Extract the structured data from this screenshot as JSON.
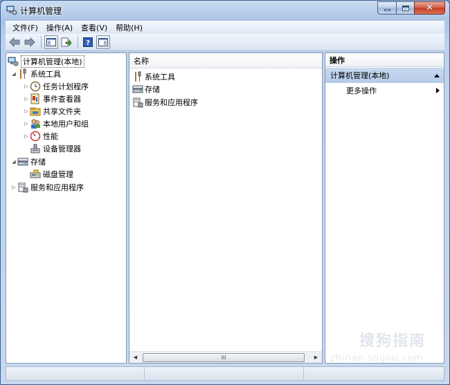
{
  "window": {
    "title": "计算机管理",
    "close_glyph": "✕"
  },
  "menu": {
    "items": [
      "文件(F)",
      "操作(A)",
      "查看(V)",
      "帮助(H)"
    ]
  },
  "tree": {
    "root": "计算机管理(本地)",
    "system_tools": "系统工具",
    "task_scheduler": "任务计划程序",
    "event_viewer": "事件查看器",
    "shared_folders": "共享文件夹",
    "local_users": "本地用户和组",
    "performance": "性能",
    "device_manager": "设备管理器",
    "storage": "存储",
    "disk_management": "磁盘管理",
    "services_apps": "服务和应用程序"
  },
  "list": {
    "column_name": "名称",
    "items": [
      "系统工具",
      "存储",
      "服务和应用程序"
    ],
    "scroll_thumb_grip": "III"
  },
  "actions": {
    "header": "操作",
    "section": "计算机管理(本地)",
    "more": "更多操作"
  },
  "watermark": {
    "logo_letter": "S",
    "text": "搜狗指南",
    "url": "zhinan.sogou.com"
  },
  "colors": {
    "title_bar": "#bcd2ee",
    "close_button": "#c13b22",
    "action_section": "#b5cbe8"
  }
}
